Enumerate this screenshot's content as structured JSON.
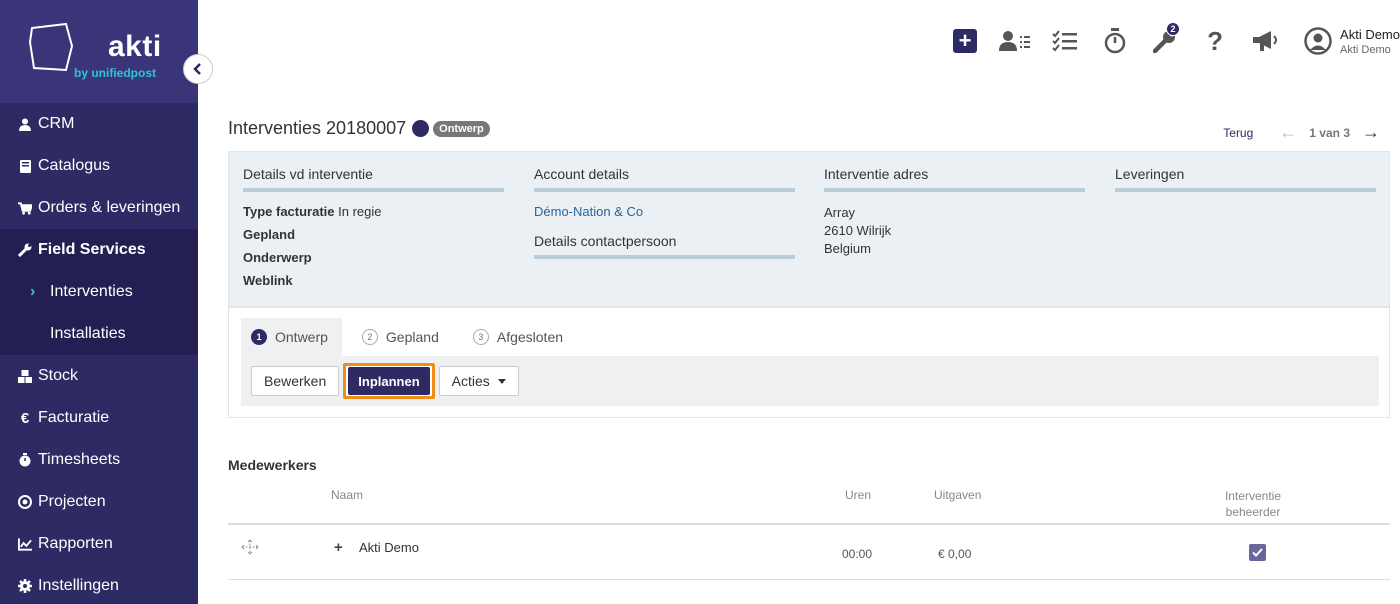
{
  "brand": {
    "name": "akti",
    "sub": "by unifiedpost"
  },
  "sidebar": {
    "items": [
      {
        "label": "CRM",
        "icon": "user-icon"
      },
      {
        "label": "Catalogus",
        "icon": "book-icon"
      },
      {
        "label": "Orders & leveringen",
        "icon": "cart-icon"
      },
      {
        "label": "Field Services",
        "icon": "wrench-icon"
      },
      {
        "label": "Interventies",
        "icon": "chevron-right-icon"
      },
      {
        "label": "Installaties"
      },
      {
        "label": "Stock",
        "icon": "cubes-icon"
      },
      {
        "label": "Facturatie",
        "icon": "euro-icon"
      },
      {
        "label": "Timesheets",
        "icon": "stopwatch-icon"
      },
      {
        "label": "Projecten",
        "icon": "target-icon"
      },
      {
        "label": "Rapporten",
        "icon": "chart-line-icon"
      },
      {
        "label": "Instellingen",
        "icon": "gear-icon"
      }
    ]
  },
  "topbar": {
    "badge_count": "2",
    "user_name": "Akti Demo",
    "user_company": "Akti Demo"
  },
  "header": {
    "title": "Interventies 20180007",
    "status": "Ontwerp",
    "back": "Terug",
    "pager": "1 van 3"
  },
  "details": {
    "col1_head": "Details vd interventie",
    "type_label": "Type facturatie",
    "type_value": "In regie",
    "gepland_label": "Gepland",
    "onderwerp_label": "Onderwerp",
    "weblink_label": "Weblink",
    "col2_head": "Account details",
    "account_link": "Démo-Nation & Co",
    "contact_head": "Details contactpersoon",
    "col3_head": "Interventie adres",
    "addr1": "Array",
    "addr2": "2610 Wilrijk",
    "addr3": "Belgium",
    "col4_head": "Leveringen"
  },
  "steps": [
    {
      "num": "1",
      "label": "Ontwerp"
    },
    {
      "num": "2",
      "label": "Gepland"
    },
    {
      "num": "3",
      "label": "Afgesloten"
    }
  ],
  "toolbar": {
    "edit": "Bewerken",
    "schedule": "Inplannen",
    "actions": "Acties"
  },
  "medewerkers": {
    "title": "Medewerkers",
    "col_name": "Naam",
    "col_hours": "Uren",
    "col_expenses": "Uitgaven",
    "col_manager_1": "Interventie",
    "col_manager_2": "beheerder",
    "row_name": "Akti Demo",
    "row_hours": "00:00",
    "row_expenses": "€ 0,00"
  }
}
